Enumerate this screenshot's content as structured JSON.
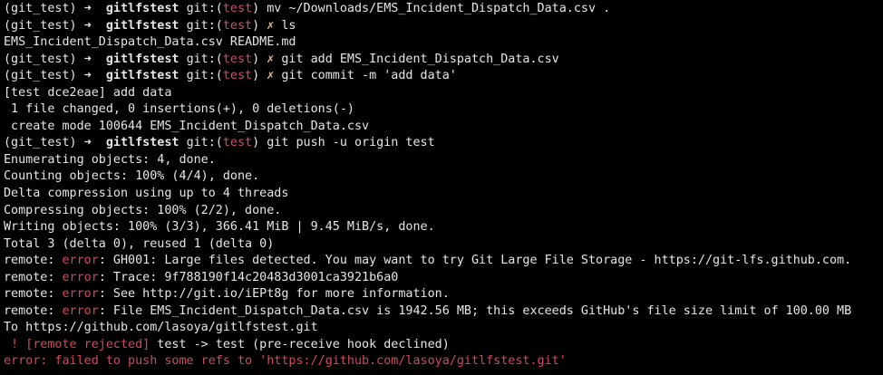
{
  "prompt": {
    "env": "(git_test)",
    "arrow": "➜",
    "dir": "gitlfstest",
    "git_prefix": "git:(",
    "branch": "test",
    "git_suffix": ")",
    "dirty": "✗"
  },
  "lines": [
    {
      "type": "prompt",
      "dirty": false,
      "cmd": "mv ~/Downloads/EMS_Incident_Dispatch_Data.csv ."
    },
    {
      "type": "prompt",
      "dirty": true,
      "cmd": "ls"
    },
    {
      "type": "output",
      "text": "EMS_Incident_Dispatch_Data.csv README.md"
    },
    {
      "type": "prompt",
      "dirty": true,
      "cmd": "git add EMS_Incident_Dispatch_Data.csv"
    },
    {
      "type": "prompt",
      "dirty": true,
      "cmd": "git commit -m 'add data'"
    },
    {
      "type": "output",
      "text": "[test dce2eae] add data"
    },
    {
      "type": "output",
      "text": " 1 file changed, 0 insertions(+), 0 deletions(-)"
    },
    {
      "type": "output",
      "text": " create mode 100644 EMS_Incident_Dispatch_Data.csv"
    },
    {
      "type": "prompt",
      "dirty": false,
      "cmd": "git push -u origin test"
    },
    {
      "type": "output",
      "text": "Enumerating objects: 4, done."
    },
    {
      "type": "output",
      "text": "Counting objects: 100% (4/4), done."
    },
    {
      "type": "output",
      "text": "Delta compression using up to 4 threads"
    },
    {
      "type": "output",
      "text": "Compressing objects: 100% (2/2), done."
    },
    {
      "type": "output",
      "text": "Writing objects: 100% (3/3), 366.41 MiB | 9.45 MiB/s, done."
    },
    {
      "type": "output",
      "text": "Total 3 (delta 0), reused 1 (delta 0)"
    },
    {
      "type": "remote_error",
      "prefix": "remote: ",
      "label": "error",
      "text": ": GH001: Large files detected. You may want to try Git Large File Storage - https://git-lfs.github.com."
    },
    {
      "type": "remote_error",
      "prefix": "remote: ",
      "label": "error",
      "text": ": Trace: 9f788190f14c20483d3001ca3921b6a0"
    },
    {
      "type": "remote_error",
      "prefix": "remote: ",
      "label": "error",
      "text": ": See http://git.io/iEPt8g for more information."
    },
    {
      "type": "remote_error",
      "prefix": "remote: ",
      "label": "error",
      "text": ": File EMS_Incident_Dispatch_Data.csv is 1942.56 MB; this exceeds GitHub's file size limit of 100.00 MB"
    },
    {
      "type": "output",
      "text": "To https://github.com/lasoya/gitlfstest.git"
    },
    {
      "type": "rejected",
      "bang": " ! ",
      "label": "[remote rejected]",
      "text": " test -> test (pre-receive hook declined)"
    },
    {
      "type": "fatal",
      "text": "error: failed to push some refs to 'https://github.com/lasoya/gitlfstest.git'"
    }
  ]
}
